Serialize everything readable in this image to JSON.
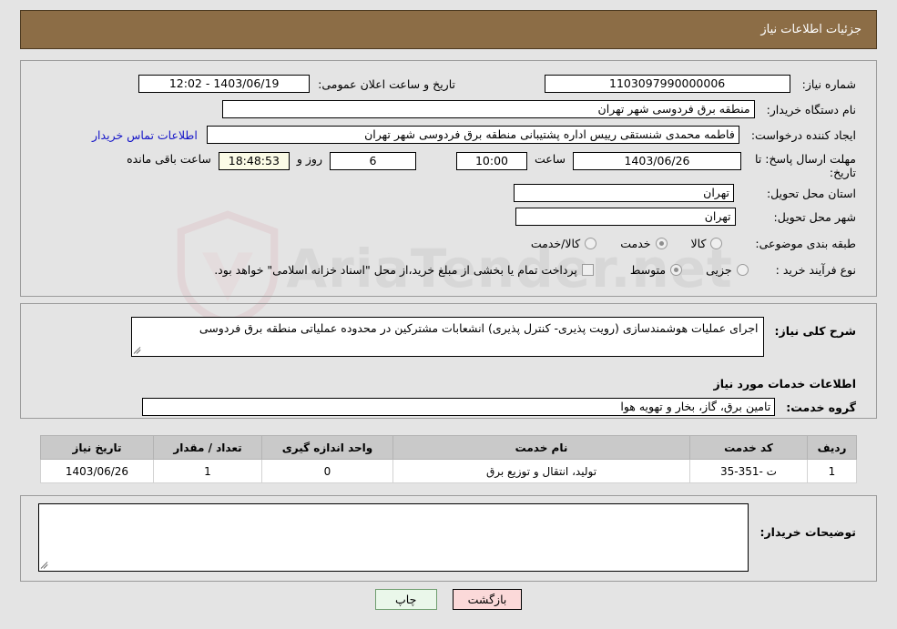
{
  "header": {
    "title": "جزئیات اطلاعات نیاز",
    "bg_color": "#8c6d46",
    "text_color": "#ffffff"
  },
  "watermark": {
    "text": "AriaTender.net"
  },
  "form": {
    "need_number": {
      "label": "شماره نیاز:",
      "value": "1103097990000006"
    },
    "buyer_org": {
      "label": "نام دستگاه خریدار:",
      "value": "منطقه برق فردوسی شهر تهران"
    },
    "requester": {
      "label": "ایجاد کننده درخواست:",
      "value": "فاطمه محمدی شنستقی رییس اداره پشتیبانی منطقه برق فردوسی شهر تهران"
    },
    "contact_link": "اطلاعات تماس خریدار",
    "public_announce": {
      "label": "تاریخ و ساعت اعلان عمومی:",
      "value": "1403/06/19 - 12:02"
    },
    "deadline": {
      "label": "مهلت ارسال پاسخ: تا تاریخ:",
      "date": "1403/06/26",
      "time_label": "ساعت",
      "time": "10:00",
      "days": "6",
      "days_label": "روز و",
      "countdown": "18:48:53",
      "remaining_label": "ساعت باقی مانده"
    },
    "province": {
      "label": "استان محل تحویل:",
      "value": "تهران"
    },
    "city": {
      "label": "شهر محل تحویل:",
      "value": "تهران"
    },
    "category": {
      "label": "طبقه بندی موضوعی:",
      "options": [
        {
          "label": "کالا",
          "selected": false
        },
        {
          "label": "خدمت",
          "selected": true
        },
        {
          "label": "کالا/خدمت",
          "selected": false
        }
      ]
    },
    "process_type": {
      "label": "نوع فرآیند خرید :",
      "options": [
        {
          "label": "جزیی",
          "selected": false
        },
        {
          "label": "متوسط",
          "selected": true
        }
      ],
      "checkbox": {
        "checked": false,
        "label": "پرداخت تمام یا بخشی از مبلغ خرید،از محل \"اسناد خزانه اسلامی\" خواهد بود."
      }
    }
  },
  "description": {
    "label": "شرح کلی نیاز:",
    "value": "اجرای عملیات هوشمندسازی (رویت پذیری- کنترل پذیری) انشعابات مشترکین در محدوده عملیاتی منطقه برق فردوسی"
  },
  "services": {
    "section_title": "اطلاعات خدمات مورد نیاز",
    "group": {
      "label": "گروه خدمت:",
      "value": "تامین برق، گاز، بخار و تهویه هوا"
    },
    "table": {
      "columns": [
        "ردیف",
        "کد خدمت",
        "نام خدمت",
        "واحد اندازه گیری",
        "تعداد / مقدار",
        "تاریخ نیاز"
      ],
      "rows": [
        [
          "1",
          "ت -351-35",
          "تولید، انتقال و توزیع برق",
          "0",
          "1",
          "1403/06/26"
        ]
      ]
    }
  },
  "buyer_notes": {
    "label": "توضیحات خریدار:",
    "value": ""
  },
  "footer": {
    "print_label": "چاپ",
    "back_label": "بازگشت"
  }
}
